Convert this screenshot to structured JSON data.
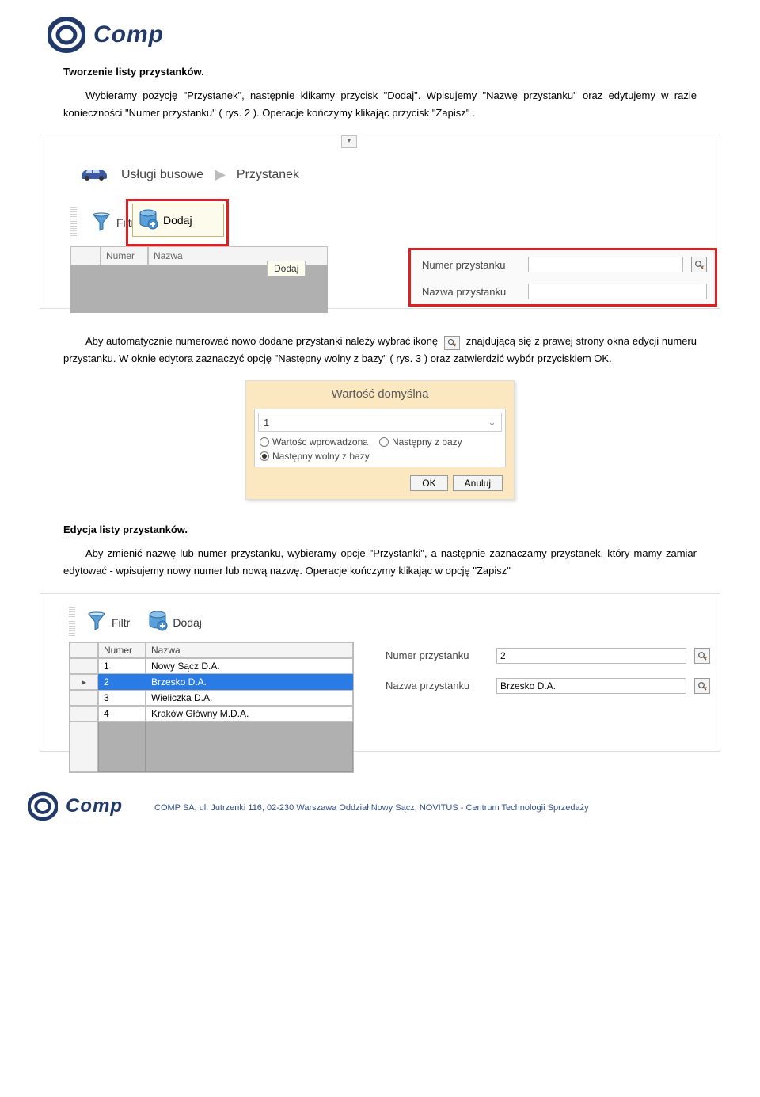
{
  "logo_text": "Comp",
  "section1_title": "Tworzenie listy przystanków.",
  "section1_para": "Wybieramy pozycję \"Przystanek\", następnie klikamy przycisk \"Dodaj\".  Wpisujemy \"Nazwę przystanku\"  oraz edytujemy w razie konieczności \"Numer przystanku\" ( rys. 2 ). Operacje kończymy klikając przycisk  \"Zapisz\" .",
  "shot1": {
    "crumb1": "Usługi busowe",
    "crumb2": "Przystanek",
    "filtr": "Filtr",
    "dodaj": "Dodaj",
    "header_numer": "Numer",
    "header_nazwa": "Nazwa",
    "tooltip": "Dodaj",
    "form_num_label": "Numer przystanku",
    "form_name_label": "Nazwa przystanku",
    "form_num_value": "",
    "form_name_value": ""
  },
  "mid_para_a": "Aby  automatycznie  numerować  nowo  dodane  przystanki  należy  wybrać  ikonę",
  "mid_para_b": "znajdującą się z prawej strony okna edycji numeru przystanku.   W oknie edytora zaznaczyć opcję \"Następny wolny z bazy\" ( rys. 3 ) oraz zatwierdzić  wybór przyciskiem OK.",
  "shot2": {
    "title": "Wartość domyślna",
    "value": "1",
    "opt1": "Wartośc wprowadzona",
    "opt2": "Następny z bazy",
    "opt3": "Następny wolny z bazy",
    "ok": "OK",
    "cancel": "Anuluj"
  },
  "section2_title": "Edycja listy przystanków.",
  "section2_para": "Aby zmienić nazwę lub numer przystanku, wybieramy opcje \"Przystanki\", a następnie zaznaczamy  przystanek, który mamy zamiar edytować -  wpisujemy nowy numer lub nową nazwę. Operacje kończymy klikając w opcję \"Zapisz\"",
  "shot3": {
    "filtr": "Filtr",
    "dodaj": "Dodaj",
    "header_numer": "Numer",
    "header_nazwa": "Nazwa",
    "rows": [
      {
        "num": "1",
        "name": "Nowy Sącz D.A."
      },
      {
        "num": "2",
        "name": "Brzesko D.A."
      },
      {
        "num": "3",
        "name": "Wieliczka D.A."
      },
      {
        "num": "4",
        "name": "Kraków Główny M.D.A."
      }
    ],
    "selected_index": 1,
    "form_num_label": "Numer przystanku",
    "form_name_label": "Nazwa przystanku",
    "form_num_value": "2",
    "form_name_value": "Brzesko D.A."
  },
  "footer": "COMP SA, ul. Jutrzenki 116, 02-230 Warszawa Oddział Nowy Sącz, NOVITUS - Centrum Technologii Sprzedaży"
}
